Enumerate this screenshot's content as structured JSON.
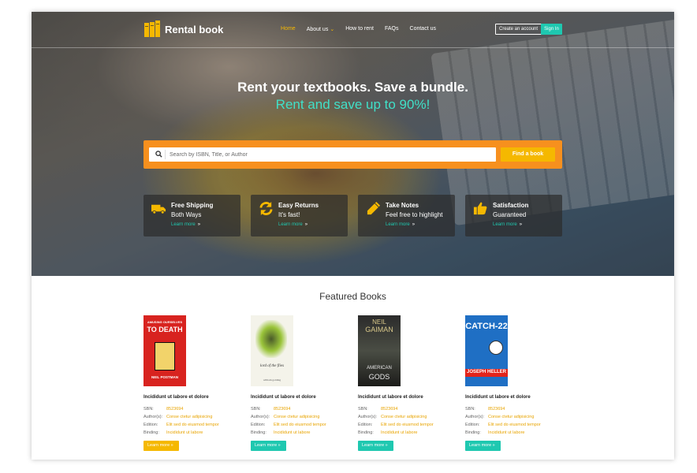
{
  "brand": {
    "name": "Rental book",
    "logo_color": "#f5b800"
  },
  "nav": {
    "items": [
      {
        "label": "Home",
        "active": true
      },
      {
        "label": "About us",
        "has_dropdown": true
      },
      {
        "label": "How to rent"
      },
      {
        "label": "FAQs"
      },
      {
        "label": "Contact us"
      }
    ],
    "create_account": "Create an account",
    "sign_in": "Sign In"
  },
  "hero": {
    "headline": "Rent your textbooks. Save a bundle.",
    "subheadline": "Rent and save up to 90%!",
    "search_placeholder": "Search by ISBN, Title, or Author",
    "find_button": "Find a book"
  },
  "features": [
    {
      "title": "Free Shipping",
      "subtitle": "Both Ways",
      "link": "Learn more",
      "icon": "truck-icon"
    },
    {
      "title": "Easy Returns",
      "subtitle": "It's fast!",
      "link": "Learn more",
      "icon": "refresh-icon"
    },
    {
      "title": "Take Notes",
      "subtitle": "Feel free to highlight",
      "link": "Learn more",
      "icon": "pencil-icon"
    },
    {
      "title": "Satisfaction",
      "subtitle": "Guaranteed",
      "link": "Learn more",
      "icon": "thumbs-up-icon"
    }
  ],
  "featured": {
    "title": "Featured Books",
    "labels": {
      "isbn": "SBN:",
      "authors": "Author(s):",
      "edition": "Edition:",
      "binding": "Binding:"
    },
    "books": [
      {
        "title": "Incididunt ut labore et dolore",
        "isbn": "8523694",
        "authors": "Conse ctetur adipisicing",
        "edition": "Elit sed do eiusmod tempor",
        "binding": "Incididunt ut labore",
        "button": "Learn more",
        "button_color": "yellow",
        "cover": {
          "line1": "AMUSING OURSELVES",
          "line2": "TO DEATH",
          "author": "NEIL POSTMAN"
        }
      },
      {
        "title": "Incididunt ut labore et dolore",
        "isbn": "8523694",
        "authors": "Conse ctetur adipisicing",
        "edition": "Elit sed do eiusmod tempor",
        "binding": "Incididunt ut labore",
        "button": "Learn more",
        "button_color": "teal",
        "cover": {
          "line1": "lord of the flies",
          "author": "william golding"
        }
      },
      {
        "title": "Incididunt ut labore et dolore",
        "isbn": "8523694",
        "authors": "Conse ctetur adipisicing",
        "edition": "Elit sed do eiusmod tempor",
        "binding": "Incididunt ut labore",
        "button": "Learn more",
        "button_color": "teal",
        "cover": {
          "line1": "NEIL",
          "line2": "GAIMAN",
          "line3": "AMERICAN",
          "line4": "GODS"
        }
      },
      {
        "title": "Incididunt ut labore et dolore",
        "isbn": "8523694",
        "authors": "Conse ctetur adipisicing",
        "edition": "Elit sed do eiusmod tempor",
        "binding": "Incididunt ut labore",
        "button": "Learn more",
        "button_color": "teal",
        "cover": {
          "line1": "CATCH-22",
          "author": "JOSEPH HELLER"
        }
      }
    ]
  },
  "colors": {
    "accent_orange": "#f7901e",
    "accent_yellow": "#f5b800",
    "accent_teal": "#1fc8b0",
    "subheadline": "#40e0c8"
  }
}
